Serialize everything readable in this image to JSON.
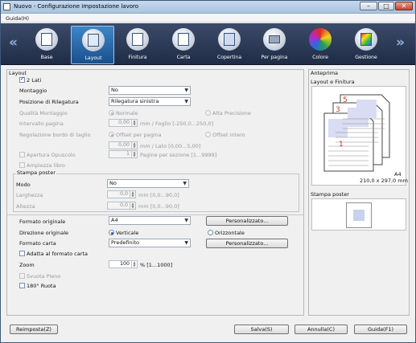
{
  "window": {
    "title": "Nuovo - Configurazione impostazione lavoro",
    "min": "–",
    "max": "□",
    "close": "✕"
  },
  "menu": {
    "help": "Guida(H)"
  },
  "toolbar": {
    "items": [
      {
        "label": "Base",
        "icon": "base-icon"
      },
      {
        "label": "Layout",
        "icon": "layout-icon"
      },
      {
        "label": "Finitura",
        "icon": "finishing-icon"
      },
      {
        "label": "Carta",
        "icon": "paper-icon"
      },
      {
        "label": "Copertina",
        "icon": "cover-icon"
      },
      {
        "label": "Per pagina",
        "icon": "per-page-icon"
      },
      {
        "label": "Colore",
        "icon": "color-icon"
      },
      {
        "label": "Gestione",
        "icon": "management-icon"
      }
    ],
    "prev": "«",
    "next": "»",
    "active": "Layout"
  },
  "layout": {
    "group_title": "Layout",
    "duplex": {
      "label": "2 Lati",
      "checked": true
    },
    "montaggio": {
      "label": "Montaggio",
      "value": "No"
    },
    "binding_position": {
      "label": "Posizione di Rilegatura",
      "value": "Rilegatura sinistra"
    },
    "quality": {
      "label": "Qualità Montaggio",
      "opt1": "Normale",
      "opt2": "Alta Precisione"
    },
    "page_interval": {
      "label": "Intervallo pagina",
      "value": "0,00",
      "unit": "mm / Foglio [-250,0...250,0]"
    },
    "trim": {
      "label": "Regolazione bordo di taglio",
      "opt1": "Offset per pagina",
      "opt2": "Offset intero",
      "value": "0,00",
      "unit": "mm / Lato [0,00...5,00]"
    },
    "booklet": {
      "label": "Apertura Opuscolo",
      "value": "1",
      "unit": "Pagine per sezione [1...9999]"
    },
    "book_width": {
      "label": "Ampiezza libro"
    },
    "poster": {
      "group_title": "Stampa poster",
      "mode_label": "Modo",
      "mode_value": "No",
      "width_label": "Larghezza",
      "width_value": "0,0",
      "width_unit": "mm [0,0...90,0]",
      "height_label": "Altezza",
      "height_value": "0,0",
      "height_unit": "mm [0,0...90,0]"
    },
    "original_format": {
      "label": "Formato originale",
      "value": "A4",
      "button": "Personalizzato..."
    },
    "original_direction": {
      "label": "Direzione originale",
      "opt1": "Verticale",
      "opt2": "Orizzontale"
    },
    "paper_format": {
      "label": "Formato carta",
      "value": "Predefinito",
      "button": "Personalizzato..."
    },
    "fit_to_paper": {
      "label": "Adatta al formato carta"
    },
    "zoom": {
      "label": "Zoom",
      "value": "100",
      "unit": "% [1...1000]"
    },
    "empty_full": {
      "label": "Svuota Pieno"
    },
    "rotate180": {
      "label": "180° Ruota"
    }
  },
  "preview": {
    "title": "Anteprima",
    "subtitle": "Layout e Finitura",
    "pages": [
      "5",
      "3",
      "1"
    ],
    "paper_size": "A4",
    "paper_dims": "210,0 x 297,0 mm",
    "poster_title": "Stampa poster"
  },
  "footer": {
    "reset": "Reimposta(Z)",
    "save": "Salva(S)",
    "cancel": "Annulla(C)",
    "help": "Guida(F1)"
  }
}
